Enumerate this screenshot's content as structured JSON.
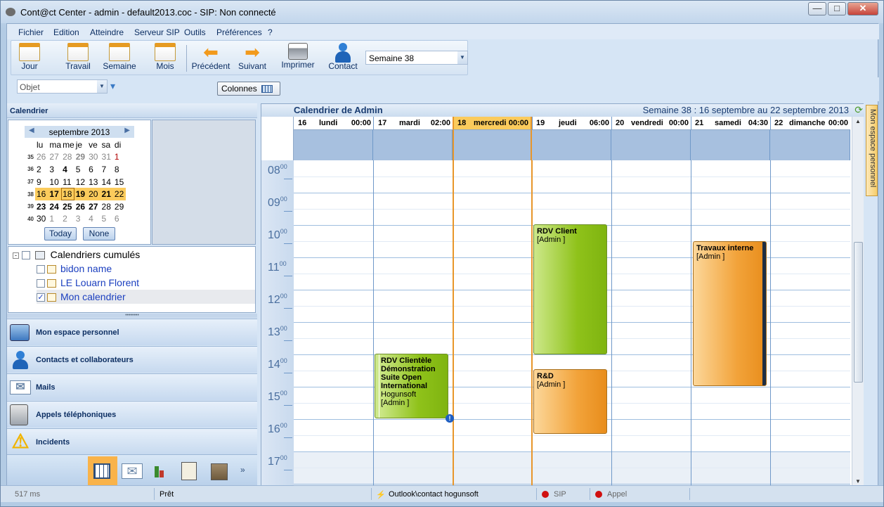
{
  "window": {
    "title": "Cont@ct Center - admin - default2013.coc - SIP: Non connecté"
  },
  "menu": [
    "Fichier",
    "Edition",
    "Atteindre",
    "Serveur SIP",
    "Outils",
    "Préférences",
    "?"
  ],
  "toolbar": {
    "jour": "Jour",
    "travail": "Travail",
    "semaine": "Semaine",
    "mois": "Mois",
    "precedent": "Précédent",
    "suivant": "Suivant",
    "imprimer": "Imprimer",
    "contact": "Contact",
    "week_select": "Semaine 38"
  },
  "toolbar2": {
    "objet_placeholder": "Objet",
    "colonnes": "Colonnes"
  },
  "left": {
    "header": "Calendrier",
    "mini_cal": {
      "month": "septembre 2013",
      "weekdays": [
        "lu",
        "ma",
        "me",
        "je",
        "ve",
        "sa",
        "di"
      ],
      "weeks": [
        {
          "wk": "35",
          "days": [
            "26",
            "27",
            "28",
            "29",
            "30",
            "31",
            "1"
          ]
        },
        {
          "wk": "36",
          "days": [
            "2",
            "3",
            "4",
            "5",
            "6",
            "7",
            "8"
          ]
        },
        {
          "wk": "37",
          "days": [
            "9",
            "10",
            "11",
            "12",
            "13",
            "14",
            "15"
          ]
        },
        {
          "wk": "38",
          "days": [
            "16",
            "17",
            "18",
            "19",
            "20",
            "21",
            "22"
          ]
        },
        {
          "wk": "39",
          "days": [
            "23",
            "24",
            "25",
            "26",
            "27",
            "28",
            "29"
          ]
        },
        {
          "wk": "40",
          "days": [
            "30",
            "1",
            "2",
            "3",
            "4",
            "5",
            "6"
          ]
        }
      ],
      "today": "Today",
      "none": "None"
    },
    "tree": {
      "root": "Calendriers cumulés",
      "items": [
        "bidon name",
        "LE Louarn Florent",
        "Mon calendrier"
      ]
    },
    "nav": [
      "Mon espace personnel",
      "Contacts et collaborateurs",
      "Mails",
      "Appels téléphoniques",
      "Incidents"
    ]
  },
  "calendar": {
    "title": "Calendrier de Admin",
    "week_label": "Semaine 38 :  16 septembre au 22 septembre 2013",
    "days": [
      {
        "num": "16",
        "name": "lundi",
        "time": "00:00"
      },
      {
        "num": "17",
        "name": "mardi",
        "time": "02:00"
      },
      {
        "num": "18",
        "name": "mercredi",
        "time": "00:00"
      },
      {
        "num": "19",
        "name": "jeudi",
        "time": "06:00"
      },
      {
        "num": "20",
        "name": "vendredi",
        "time": "00:00"
      },
      {
        "num": "21",
        "name": "samedi",
        "time": "04:30"
      },
      {
        "num": "22",
        "name": "dimanche",
        "time": "00:00"
      }
    ],
    "hours": [
      "08",
      "09",
      "10",
      "11",
      "12",
      "13",
      "14",
      "15",
      "16",
      "17"
    ],
    "minutes": "00",
    "events": [
      {
        "title": "RDV Client",
        "owner": "[Admin ]"
      },
      {
        "title": "Travaux interne",
        "owner": "[Admin ]"
      },
      {
        "title": "R&D",
        "owner": "[Admin ]"
      },
      {
        "title": "RDV Clientèle Démonstration Suite Open International",
        "sub": "Hogunsoft",
        "owner": "[Admin ]"
      }
    ]
  },
  "side_tab": "Mon espace personnel",
  "status": {
    "timing": "517 ms",
    "state": "Prêt",
    "outlook": "Outlook\\contact hogunsoft",
    "sip": "SIP",
    "appel": "Appel"
  }
}
